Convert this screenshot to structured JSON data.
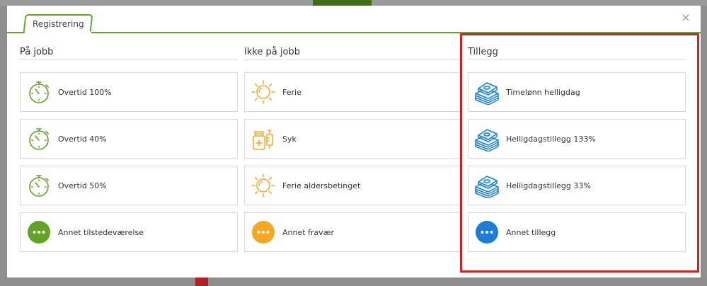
{
  "colors": {
    "green": "#62a323",
    "orange": "#f5a623",
    "blue": "#1a7ed6",
    "highlight": "#d42020"
  },
  "modal": {
    "tab_label": "Registrering",
    "close_label": "×"
  },
  "columns": [
    {
      "title": "På jobb",
      "items": [
        {
          "label": "Overtid 100%",
          "icon": "stopwatch-icon"
        },
        {
          "label": "Overtid 40%",
          "icon": "stopwatch-icon"
        },
        {
          "label": "Overtid 50%",
          "icon": "stopwatch-icon"
        },
        {
          "label": "Annet tilstedeværelse",
          "icon": "more-icon"
        }
      ]
    },
    {
      "title": "Ikke på jobb",
      "items": [
        {
          "label": "Ferie",
          "icon": "sun-icon"
        },
        {
          "label": "Syk",
          "icon": "medicine-icon"
        },
        {
          "label": "Ferie aldersbetinget",
          "icon": "sun-icon"
        },
        {
          "label": "Annet fravær",
          "icon": "more-icon"
        }
      ]
    },
    {
      "title": "Tillegg",
      "items": [
        {
          "label": "Timelønn helligdag",
          "icon": "money-stack-icon"
        },
        {
          "label": "Helligdagstillegg 133%",
          "icon": "money-stack-icon"
        },
        {
          "label": "Helligdagstillegg 33%",
          "icon": "money-stack-icon"
        },
        {
          "label": "Annet tillegg",
          "icon": "more-icon"
        }
      ]
    }
  ]
}
